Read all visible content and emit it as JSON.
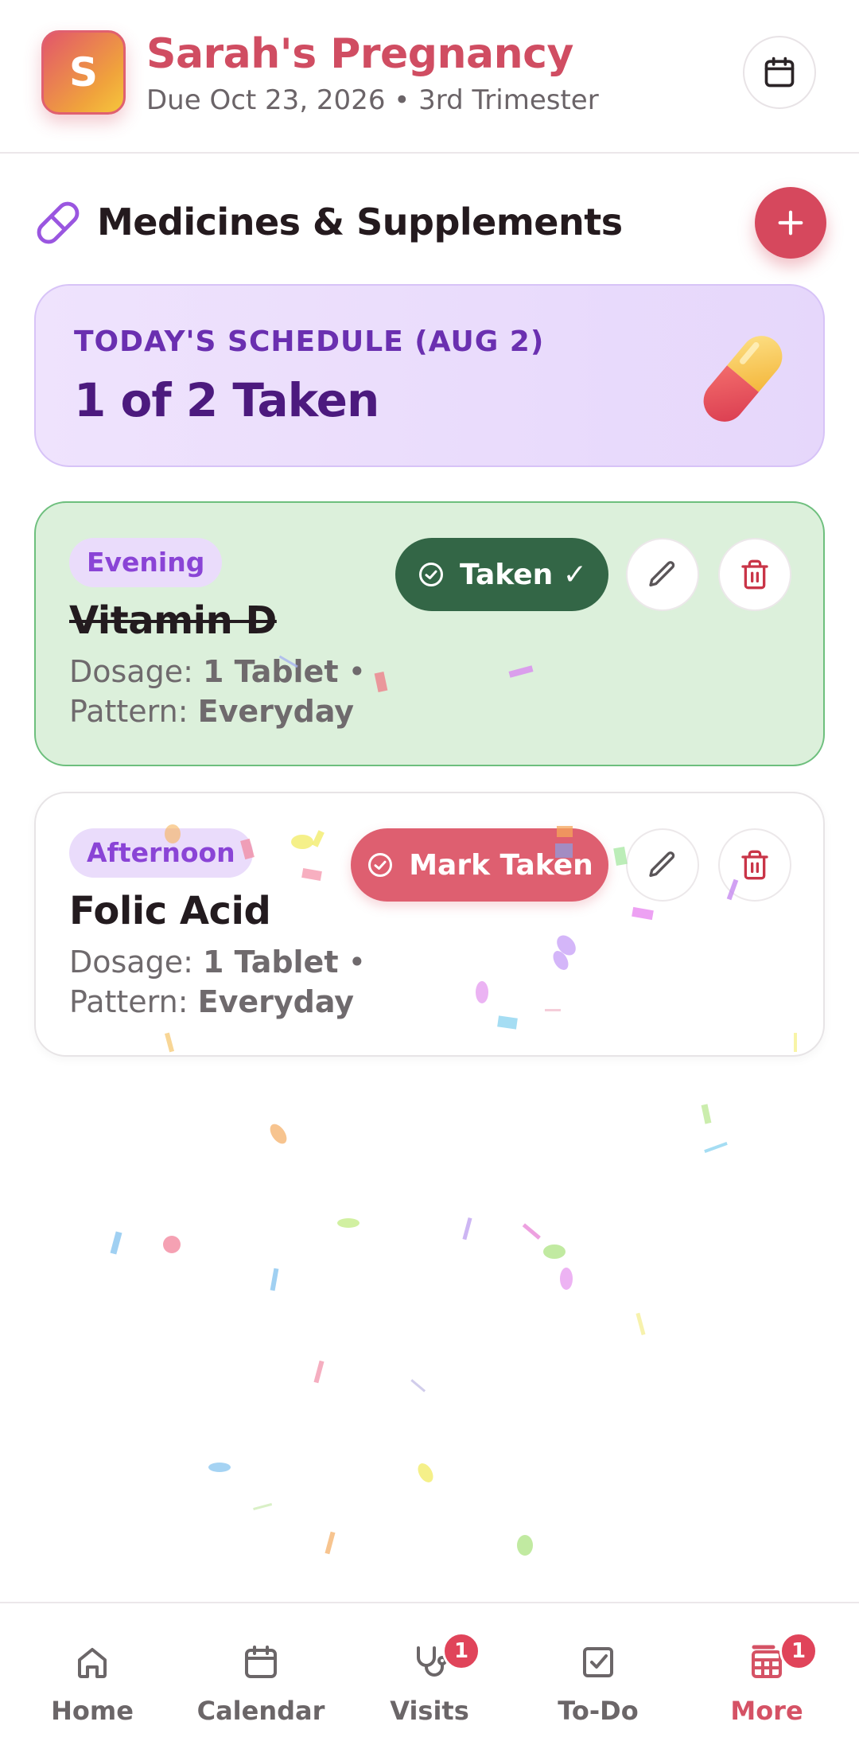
{
  "header": {
    "avatar_letter": "S",
    "title": "Sarah's Pregnancy",
    "subtitle": "Due Oct 23, 2026 • 3rd Trimester",
    "calendar_icon": "calendar-icon"
  },
  "section": {
    "icon": "pill-icon",
    "title": "Medicines & Supplements",
    "add_icon": "plus-icon"
  },
  "schedule": {
    "label": "TODAY'S SCHEDULE (AUG 2)",
    "count_text": "1 of 2 Taken",
    "taken": 1,
    "total": 2
  },
  "medicines": [
    {
      "time": "Evening",
      "name": "Vitamin D",
      "dosage_label": "Dosage:",
      "dosage": "1 Tablet",
      "pattern_label": "Pattern:",
      "pattern": "Everyday",
      "status_label": "Taken ✓",
      "taken": true
    },
    {
      "time": "Afternoon",
      "name": "Folic Acid",
      "dosage_label": "Dosage:",
      "dosage": "1 Tablet",
      "pattern_label": "Pattern:",
      "pattern": "Everyday",
      "status_label": "Mark Taken",
      "taken": false
    }
  ],
  "nav": {
    "items": [
      {
        "label": "Home",
        "icon": "home-icon",
        "badge": ""
      },
      {
        "label": "Calendar",
        "icon": "calendar-icon",
        "badge": ""
      },
      {
        "label": "Visits",
        "icon": "stethoscope-icon",
        "badge": "1"
      },
      {
        "label": "To-Do",
        "icon": "checkbox-icon",
        "badge": ""
      },
      {
        "label": "More",
        "icon": "grid-icon",
        "badge": "1",
        "active": true
      }
    ]
  },
  "colors": {
    "brand": "#d04d62",
    "taken_button": "#336646",
    "mark_button": "#de5f70",
    "schedule_bg": "#e6d7fb",
    "taken_card_bg": "#dcf0db"
  }
}
